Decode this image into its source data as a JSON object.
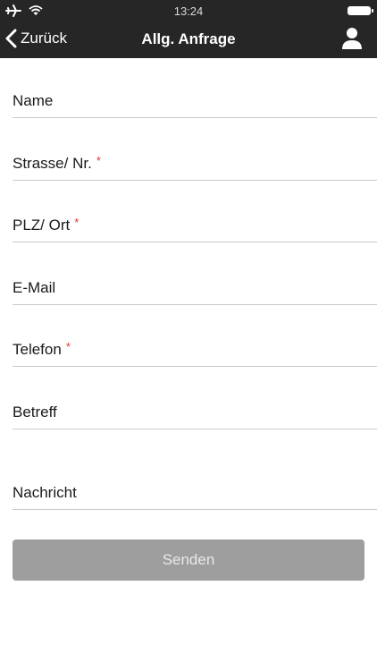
{
  "status": {
    "time": "13:24"
  },
  "nav": {
    "back_label": "Zurück",
    "title": "Allg. Anfrage",
    "user_icon": "user-icon"
  },
  "form": {
    "fields": [
      {
        "label": "Name",
        "required": false
      },
      {
        "label": "Strasse/ Nr.",
        "required": true
      },
      {
        "label": "PLZ/ Ort",
        "required": true
      },
      {
        "label": "E-Mail",
        "required": false
      },
      {
        "label": "Telefon",
        "required": true
      },
      {
        "label": "Betreff",
        "required": false
      },
      {
        "label": "Nachricht",
        "required": false
      }
    ],
    "required_marker": "*",
    "submit_label": "Senden"
  },
  "colors": {
    "header": "#262626",
    "required": "#e0352b",
    "button": "#9e9e9e",
    "divider": "#c9c9c9"
  }
}
